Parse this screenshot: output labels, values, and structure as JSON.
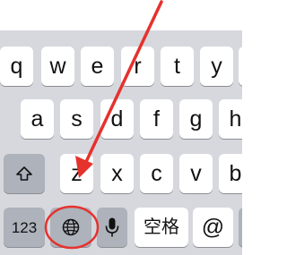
{
  "keyboard": {
    "row1": [
      "q",
      "w",
      "e",
      "r",
      "t",
      "y"
    ],
    "row2": [
      "a",
      "s",
      "d",
      "f",
      "g",
      "h"
    ],
    "row3": [
      "z",
      "x",
      "c",
      "v",
      "b"
    ],
    "bottom": {
      "numbers_label": "123",
      "space_label": "空格",
      "at_label": "@"
    },
    "icons": {
      "shift": "shift-icon",
      "globe": "globe-icon",
      "mic": "microphone-icon"
    }
  },
  "annotation": {
    "color": "#e5322d"
  }
}
